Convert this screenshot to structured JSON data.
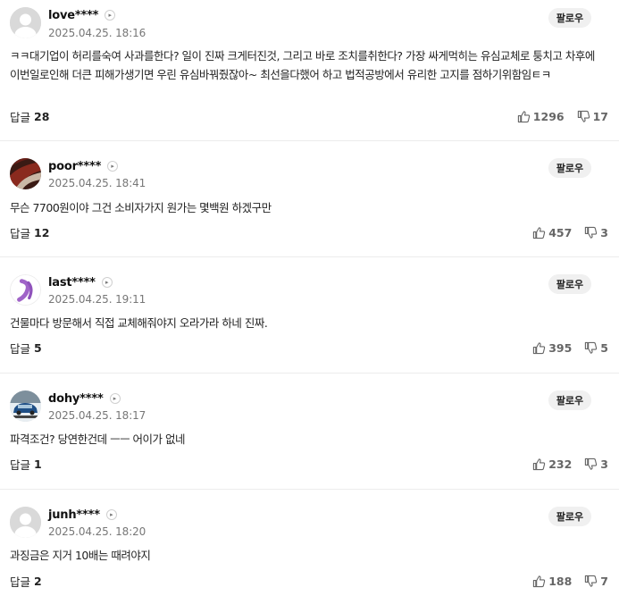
{
  "comments": [
    {
      "nickname": "love****",
      "date": "2025.04.25. 18:16",
      "follow_label": "팔로우",
      "text": "ㅋㅋ대기업이 허리를숙여 사과를한다? 일이 진짜 크게터진것, 그리고 바로 조치를취한다? 가장 싸게먹히는 유심교체로 퉁치고 차후에 이번일로인해 더큰 피해가생기면 우린 유심바꿔줬잖아~ 최선을다했어 하고 법적공방에서 유리한 고지를 점하기위함임ㅌㅋ",
      "reply_label": "답글",
      "reply_count": "28",
      "likes": "1296",
      "dislikes": "17",
      "avatar": "default-avatar-icon"
    },
    {
      "nickname": "poor****",
      "date": "2025.04.25. 18:41",
      "follow_label": "팔로우",
      "text": "무슨 7700원이야 그건 소비자가지 원가는 몇백원 하겠구만",
      "reply_label": "답글",
      "reply_count": "12",
      "likes": "457",
      "dislikes": "3",
      "avatar": "photo-avatar"
    },
    {
      "nickname": "last****",
      "date": "2025.04.25. 19:11",
      "follow_label": "팔로우",
      "text": "건물마다 방문해서 직접 교체해줘야지 오라가라 하네 진짜.",
      "reply_label": "답글",
      "reply_count": "5",
      "likes": "395",
      "dislikes": "5",
      "avatar": "purple-brush-avatar"
    },
    {
      "nickname": "dohy****",
      "date": "2025.04.25. 18:17",
      "follow_label": "팔로우",
      "text": "파격조건? 당연한건데 ㅡㅡ 어이가 없네",
      "reply_label": "답글",
      "reply_count": "1",
      "likes": "232",
      "dislikes": "3",
      "avatar": "car-photo-avatar"
    },
    {
      "nickname": "junh****",
      "date": "2025.04.25. 18:20",
      "follow_label": "팔로우",
      "text": "과징금은 지거 10배는 때려야지",
      "reply_label": "답글",
      "reply_count": "2",
      "likes": "188",
      "dislikes": "7",
      "avatar": "default-avatar-icon"
    }
  ],
  "colors": {
    "text": "#222222",
    "meta": "#777777",
    "divider": "#ececec",
    "follow_bg": "#f0f0f0",
    "purple_accent": "#9b5fc0"
  }
}
